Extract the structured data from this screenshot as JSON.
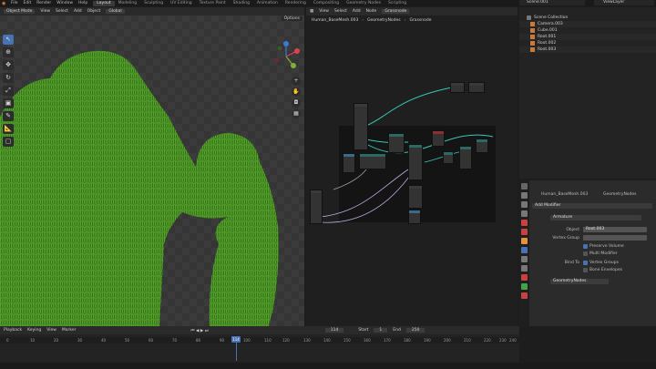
{
  "topbar": {
    "menus": [
      "File",
      "Edit",
      "Render",
      "Window",
      "Help"
    ],
    "workspaces": [
      "Layout",
      "Modeling",
      "Sculpting",
      "UV Editing",
      "Texture Paint",
      "Shading",
      "Animation",
      "Rendering",
      "Compositing",
      "Geometry Nodes",
      "Scripting"
    ],
    "active_workspace": "Layout",
    "scene": "Scene.001",
    "view_layer": "ViewLayer"
  },
  "viewport": {
    "mode": "Object Mode",
    "menus": [
      "View",
      "Select",
      "Add",
      "Object"
    ],
    "orientation": "Global",
    "options": "Options",
    "grass_color": "#3e8a1e"
  },
  "node_editor": {
    "menus": [
      "View",
      "Select",
      "Add",
      "Node"
    ],
    "node_group": "Grassnode",
    "breadcrumb": [
      "Human_BaseMesh.003",
      "GeometryNodes",
      "Grassnode"
    ]
  },
  "outliner": {
    "title": "Scene Collection",
    "items": [
      {
        "name": "Camera.003"
      },
      {
        "name": "Cube.001"
      },
      {
        "name": "Root.001"
      },
      {
        "name": "Root.002"
      },
      {
        "name": "Root.003"
      }
    ]
  },
  "properties": {
    "object": "Human_BaseMesh.003",
    "modifier_tab": "GeometryNodes",
    "add_modifier": "Add Modifier",
    "armature_modifier": "Armature",
    "object_label": "Object",
    "object_value": "Root.003",
    "vertex_group_label": "Vertex Group",
    "preserve_volume": "Preserve Volume",
    "multi_modifier": "Multi Modifier",
    "bind_to": "Bind To",
    "vertex_groups": "Vertex Groups",
    "bone_envelopes": "Bone Envelopes",
    "geonodes_modifier": "GeometryNodes"
  },
  "timeline": {
    "menus": [
      "Playback",
      "Keying",
      "View",
      "Marker"
    ],
    "current_frame": "114",
    "start_label": "Start",
    "start": "1",
    "end_label": "End",
    "end": "250",
    "ticks": [
      "0",
      "10",
      "20",
      "30",
      "40",
      "50",
      "60",
      "70",
      "80",
      "90",
      "100",
      "110",
      "120",
      "130",
      "140",
      "150",
      "160",
      "170",
      "180",
      "190",
      "200",
      "210",
      "220",
      "230",
      "240",
      "250"
    ]
  }
}
